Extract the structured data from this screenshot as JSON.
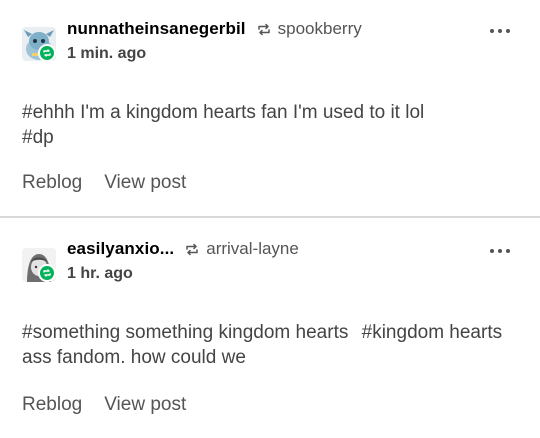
{
  "posts": [
    {
      "username": "nunnatheinsanegerbil",
      "source": "spookberry",
      "timestamp": "1 min. ago",
      "tags": [
        "#ehhh I'm a kingdom hearts fan I'm used to it lol",
        "#dp"
      ],
      "actions": {
        "reblog": "Reblog",
        "view": "View post"
      },
      "avatar_icon": "blue-creature-avatar"
    },
    {
      "username": "easilyanxio...",
      "source": "arrival-layne",
      "timestamp": "1 hr. ago",
      "tags": [
        "#something something kingdom hearts",
        "#kingdom hearts ass fandom. how could we"
      ],
      "actions": {
        "reblog": "Reblog",
        "view": "View post"
      },
      "avatar_icon": "grayscale-character-avatar"
    }
  ],
  "colors": {
    "reblog_green": "#00b259",
    "divider": "#d9d9d9",
    "muted_text": "#555555"
  }
}
